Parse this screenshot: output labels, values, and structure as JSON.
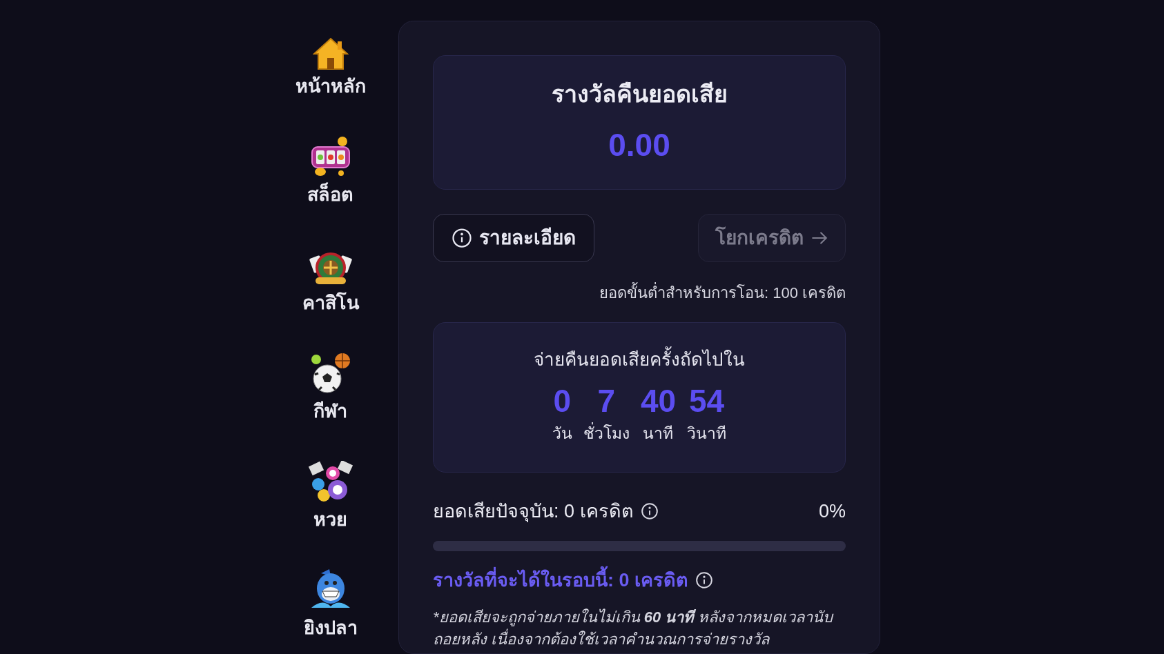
{
  "sidebar": {
    "items": [
      {
        "label": "หน้าหลัก",
        "kind": "home",
        "selected": false
      },
      {
        "label": "สล็อต",
        "kind": "slot",
        "selected": false
      },
      {
        "label": "คาสิโน",
        "kind": "casino",
        "selected": false
      },
      {
        "label": "กีฬา",
        "kind": "sports",
        "selected": false
      },
      {
        "label": "หวย",
        "kind": "lottery",
        "selected": false
      },
      {
        "label": "ยิงปลา",
        "kind": "fishing",
        "selected": false
      }
    ]
  },
  "cashback": {
    "title": "รางวัลคืนยอดเสีย",
    "amount": "0.00"
  },
  "buttons": [
    {
      "label": "รายละเอียด",
      "kind": "details",
      "disabled": false
    },
    {
      "label": "โยกเครดิต",
      "kind": "transfer",
      "disabled": true
    }
  ],
  "minimum_note": "ยอดขั้นต่ำสำหรับการโอน: 100 เครดิต",
  "countdown": {
    "title": "จ่ายคืนยอดเสียครั้งถัดไปใน",
    "units": [
      {
        "value": "0",
        "label": "วัน"
      },
      {
        "value": "7",
        "label": "ชั่วโมง"
      },
      {
        "value": "40",
        "label": "นาที"
      },
      {
        "value": "54",
        "label": "วินาที"
      }
    ]
  },
  "current_loss": {
    "label": "ยอดเสียปัจจุบัน: 0 เครดิต",
    "percent": "0%",
    "level": 0
  },
  "reward_this_round": "รางวัลที่จะได้ในรอบนี้: **0 เครดิต**",
  "footnote": "*ยอดเสียจะถูกจ่ายภายในไม่เกิน **60 นาที** หลังจากหมดเวลานับถอยหลัง เนื่องจากต้องใช้เวลาคำนวณการจ่ายรางวัล"
}
